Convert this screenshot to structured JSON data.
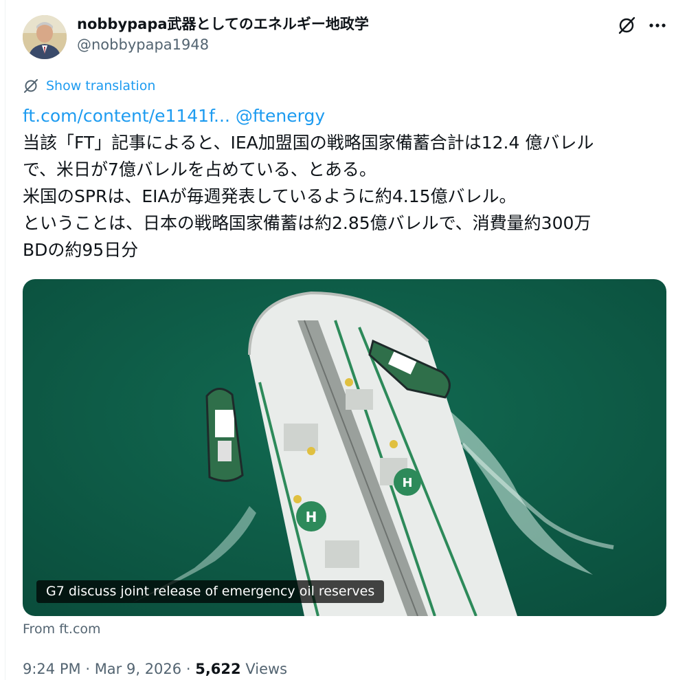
{
  "author": {
    "display_name": "nobbypapa武器としてのエネルギー地政学",
    "handle": "@nobbypapa1948"
  },
  "actions": {
    "grok_icon": "grok-slash-circle-icon",
    "more_icon": "more-horizontal-icon"
  },
  "translate": {
    "label": "Show translation",
    "icon": "translate-globe-icon"
  },
  "body": {
    "link_text": "ft.com/content/e1141f...",
    "mention": "@ftenergy",
    "lines": [
      "当該「FT」記事によると、IEA加盟国の戦略国家備蓄合計は12.4 億バレル",
      "で、米日が7億バレルを占めている、とある。",
      "米国のSPRは、EIAが毎週発表しているように約4.15億バレル。",
      "ということは、日本の戦略国家備蓄は約2.85億バレルで、消費量約300万",
      "BDの約95日分"
    ]
  },
  "card": {
    "caption": "G7 discuss joint release of emergency oil reserves",
    "source": "From ft.com"
  },
  "meta": {
    "time": "9:24 PM",
    "separator": "·",
    "date": "Mar 9, 2026",
    "views_count": "5,622",
    "views_label": "Views"
  },
  "colors": {
    "link": "#1d9bf0",
    "secondary_text": "#536471",
    "primary_text": "#0f1419",
    "sea": "#0d5a45"
  }
}
